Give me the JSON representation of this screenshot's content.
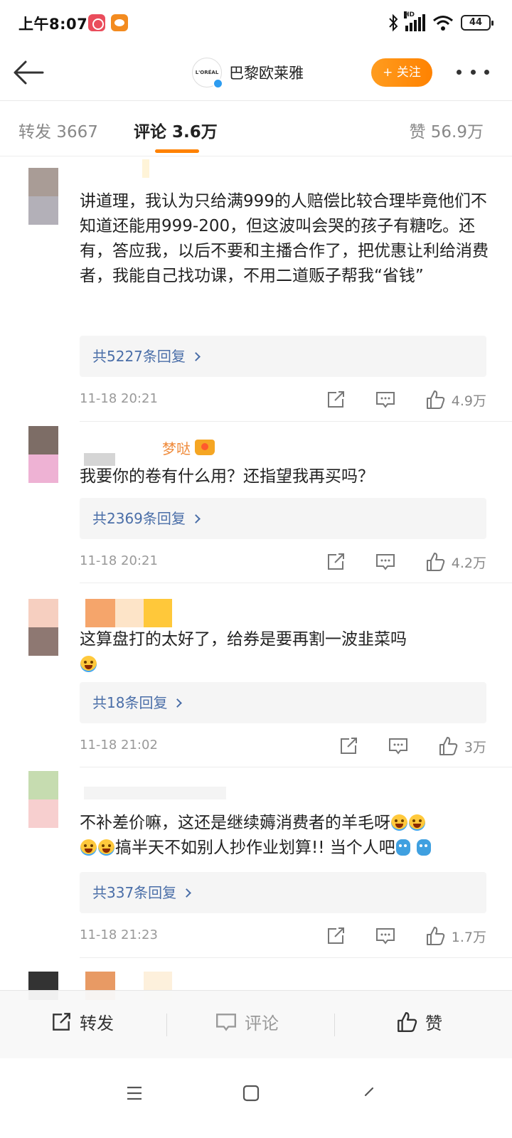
{
  "status_bar": {
    "time": "上午8:07",
    "battery": "44"
  },
  "header": {
    "brand_logo_text": "L'ORÉAL",
    "brand_name": "巴黎欧莱雅",
    "follow_label": "+ 关注"
  },
  "tabs": {
    "repost": "转发 3667",
    "comment": "评论 3.6万",
    "like": "赞 56.9万"
  },
  "comments": [
    {
      "text": "讲道理，我认为只给满999的人赔偿比较合理毕竟他们不知道还能用999-200，但这波叫会哭的孩子有糖吃。还有，答应我，以后不要和主播合作了，把优惠让利给消费者，我能自己找功课，不用二道贩子帮我“省钱”",
      "replies": "共5227条回复",
      "time": "11-18 20:21",
      "likes": "4.9万"
    },
    {
      "name_visible": "梦哒",
      "text": "我要你的卷有什么用？还指望我再买吗？",
      "replies": "共2369条回复",
      "time": "11-18 20:21",
      "likes": "4.2万"
    },
    {
      "text": "这算盘打的太好了，给券是要再割一波韭菜吗",
      "replies": "共18条回复",
      "time": "11-18 21:02",
      "likes": "3万"
    },
    {
      "text_line1": "不补差价嘛，这还是继续薅消费者的羊毛呀",
      "text_line2": "搞半天不如别人抄作业划算!! 当个人吧",
      "replies": "共337条回复",
      "time": "11-18 21:23",
      "likes": "1.7万"
    }
  ],
  "bottom_bar": {
    "repost": "转发",
    "comment": "评论",
    "like": "赞"
  },
  "colors": {
    "accent": "#ff8200",
    "link": "#4a6ea8",
    "verified": "#2d9cf0"
  }
}
